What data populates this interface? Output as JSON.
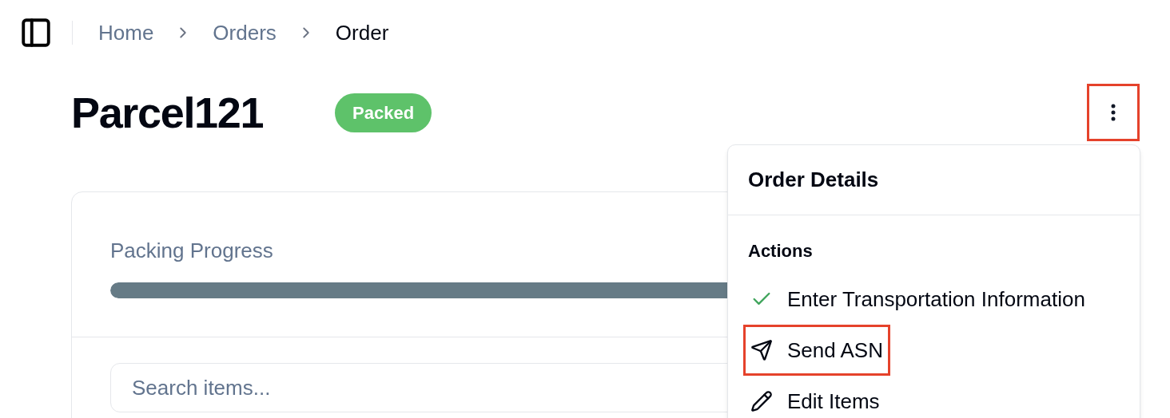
{
  "breadcrumb": [
    {
      "label": "Home",
      "current": false
    },
    {
      "label": "Orders",
      "current": false
    },
    {
      "label": "Order",
      "current": true
    }
  ],
  "title": "Parcel121",
  "status": {
    "label": "Packed",
    "color": "#5ec26a"
  },
  "more_button": {
    "highlighted": true
  },
  "progress": {
    "label": "Packing Progress",
    "level": 1
  },
  "search": {
    "placeholder": "Search items..."
  },
  "menu": {
    "title": "Order Details",
    "section": "Actions",
    "items": [
      {
        "label": "Enter Transportation Information",
        "kind": "check",
        "highlighted": false
      },
      {
        "label": "Send ASN",
        "kind": "send",
        "highlighted": true
      },
      {
        "label": "Edit Items",
        "kind": "pencil",
        "highlighted": false
      }
    ]
  }
}
